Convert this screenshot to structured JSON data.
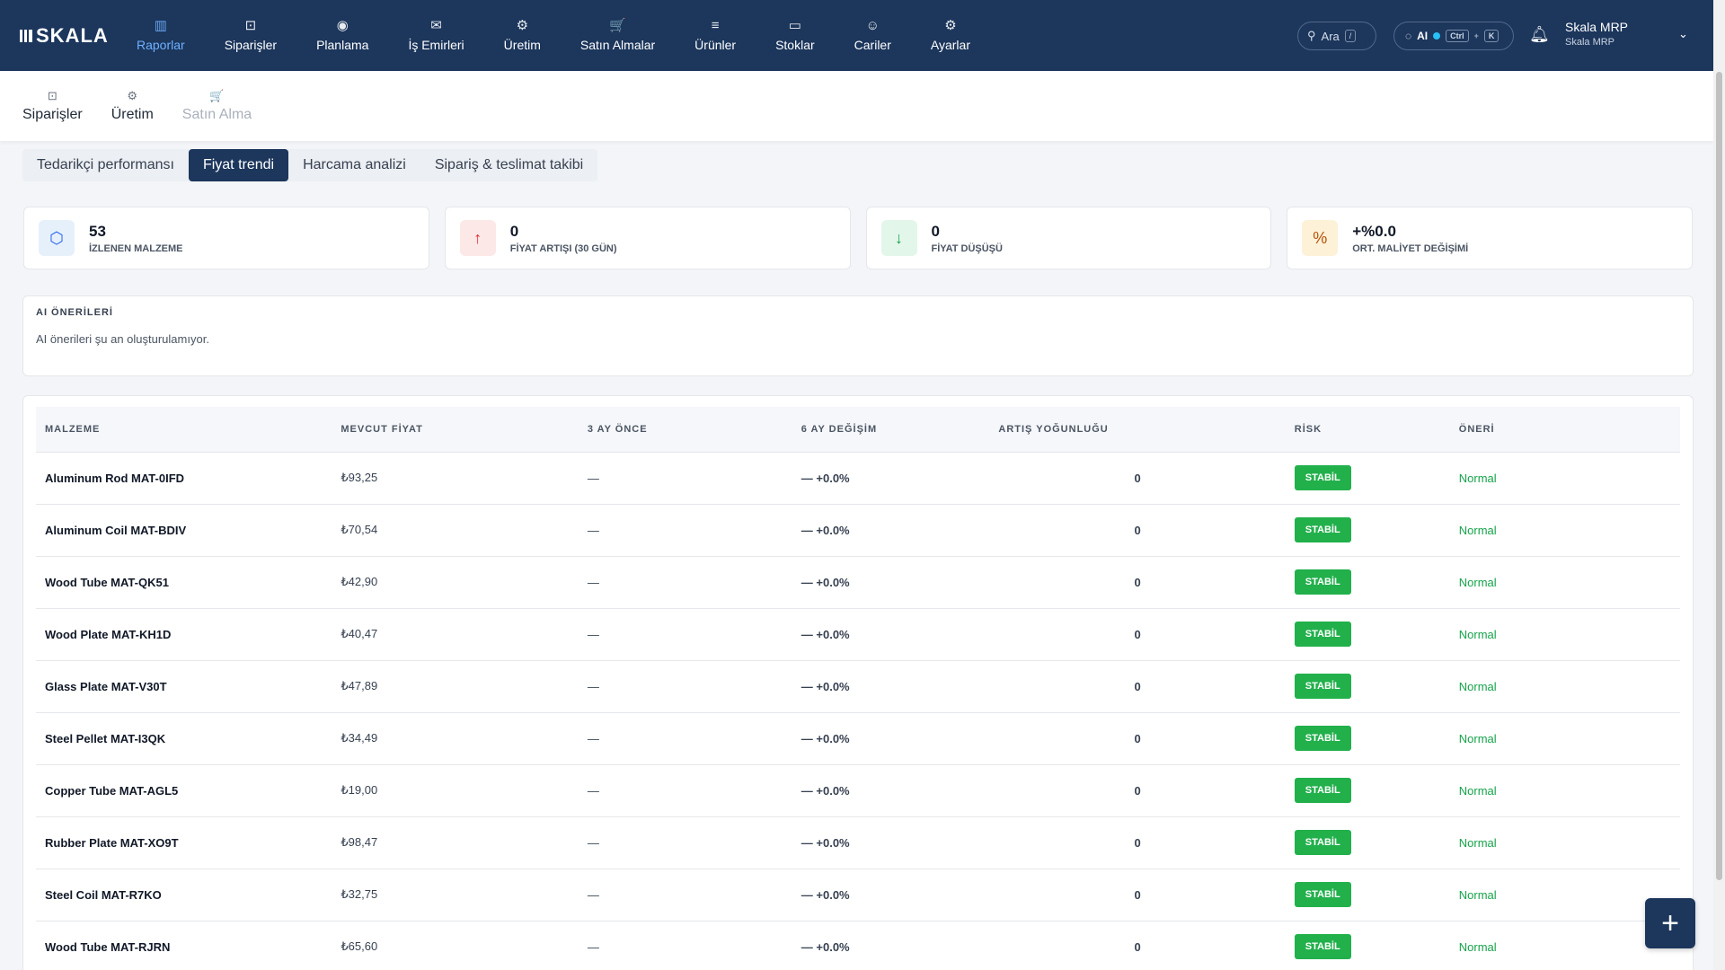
{
  "brand": "SKALA",
  "nav": [
    {
      "icon": "▥",
      "label": "Raporlar",
      "name": "nav-raporlar",
      "active": true
    },
    {
      "icon": "⊡",
      "label": "Siparişler",
      "name": "nav-siparisler"
    },
    {
      "icon": "◉",
      "label": "Planlama",
      "name": "nav-planlama"
    },
    {
      "icon": "✉",
      "label": "İş Emirleri",
      "name": "nav-is-emirleri"
    },
    {
      "icon": "⚙",
      "label": "Üretim",
      "name": "nav-uretim"
    },
    {
      "icon": "🛒",
      "label": "Satın Almalar",
      "name": "nav-satin-almalar"
    },
    {
      "icon": "≡",
      "label": "Ürünler",
      "name": "nav-urunler"
    },
    {
      "icon": "▭",
      "label": "Stoklar",
      "name": "nav-stoklar"
    },
    {
      "icon": "☺",
      "label": "Cariler",
      "name": "nav-cariler"
    },
    {
      "icon": "⚙",
      "label": "Ayarlar",
      "name": "nav-ayarlar"
    }
  ],
  "search": {
    "label": "Ara",
    "shortcut": "/"
  },
  "ai": {
    "label": "AI",
    "kbd1": "Ctrl",
    "plus": "+",
    "kbd2": "K"
  },
  "user": {
    "name": "Skala MRP",
    "org": "Skala MRP"
  },
  "subnav": [
    {
      "icon": "⊡",
      "label": "Siparişler",
      "name": "subnav-siparisler"
    },
    {
      "icon": "⚙",
      "label": "Üretim",
      "name": "subnav-uretim"
    },
    {
      "icon": "🛒",
      "label": "Satın Alma",
      "name": "subnav-satin-alma",
      "disabled": true
    }
  ],
  "tabs": [
    {
      "label": "Tedarikçi performansı",
      "name": "tab-tedarikci-performansi"
    },
    {
      "label": "Fiyat trendi",
      "name": "tab-fiyat-trendi",
      "active": true
    },
    {
      "label": "Harcama analizi",
      "name": "tab-harcama-analizi"
    },
    {
      "label": "Sipariş & teslimat takibi",
      "name": "tab-siparis-teslimat-takibi"
    }
  ],
  "kpis": [
    {
      "icon": "⬡",
      "value": "53",
      "label": "İZLENEN MALZEME",
      "bg": "#e6f0fb",
      "fg": "#2563eb",
      "name": "kpi-izlenen-malzeme"
    },
    {
      "icon": "↑",
      "value": "0",
      "label": "FİYAT ARTIŞI (30 GÜN)",
      "bg": "#fde8e8",
      "fg": "#dc2626",
      "name": "kpi-fiyat-artisi"
    },
    {
      "icon": "↓",
      "value": "0",
      "label": "FİYAT DÜŞÜŞÜ",
      "bg": "#e3f6ea",
      "fg": "#16a34a",
      "name": "kpi-fiyat-dususu"
    },
    {
      "icon": "%",
      "value": "+%0.0",
      "label": "ORT. MALİYET DEĞİŞİMİ",
      "bg": "#fdf1d8",
      "fg": "#b45309",
      "name": "kpi-ort-maliyet-degisimi"
    }
  ],
  "ai_panel": {
    "heading": "AI ÖNERİLERİ",
    "text": "AI önerileri şu an oluşturulamıyor."
  },
  "table": {
    "headers": [
      "MALZEME",
      "MEVCUT FİYAT",
      "3 AY ÖNCE",
      "6 AY DEĞİŞİM",
      "ARTIŞ YOĞUNLUĞU",
      "RİSK",
      "ÖNERİ"
    ],
    "rows": [
      [
        "Aluminum Rod MAT-0IFD",
        "₺93,25",
        "—",
        "— +0.0%",
        "0",
        "STABİL",
        "Normal"
      ],
      [
        "Aluminum Coil MAT-BDIV",
        "₺70,54",
        "—",
        "— +0.0%",
        "0",
        "STABİL",
        "Normal"
      ],
      [
        "Wood Tube MAT-QK51",
        "₺42,90",
        "—",
        "— +0.0%",
        "0",
        "STABİL",
        "Normal"
      ],
      [
        "Wood Plate MAT-KH1D",
        "₺40,47",
        "—",
        "— +0.0%",
        "0",
        "STABİL",
        "Normal"
      ],
      [
        "Glass Plate MAT-V30T",
        "₺47,89",
        "—",
        "— +0.0%",
        "0",
        "STABİL",
        "Normal"
      ],
      [
        "Steel Pellet MAT-I3QK",
        "₺34,49",
        "—",
        "— +0.0%",
        "0",
        "STABİL",
        "Normal"
      ],
      [
        "Copper Tube MAT-AGL5",
        "₺19,00",
        "—",
        "— +0.0%",
        "0",
        "STABİL",
        "Normal"
      ],
      [
        "Rubber Plate MAT-XO9T",
        "₺98,47",
        "—",
        "— +0.0%",
        "0",
        "STABİL",
        "Normal"
      ],
      [
        "Steel Coil MAT-R7KO",
        "₺32,75",
        "—",
        "— +0.0%",
        "0",
        "STABİL",
        "Normal"
      ],
      [
        "Wood Tube MAT-RJRN",
        "₺65,60",
        "—",
        "— +0.0%",
        "0",
        "STABİL",
        "Normal"
      ]
    ]
  },
  "fab": "+"
}
